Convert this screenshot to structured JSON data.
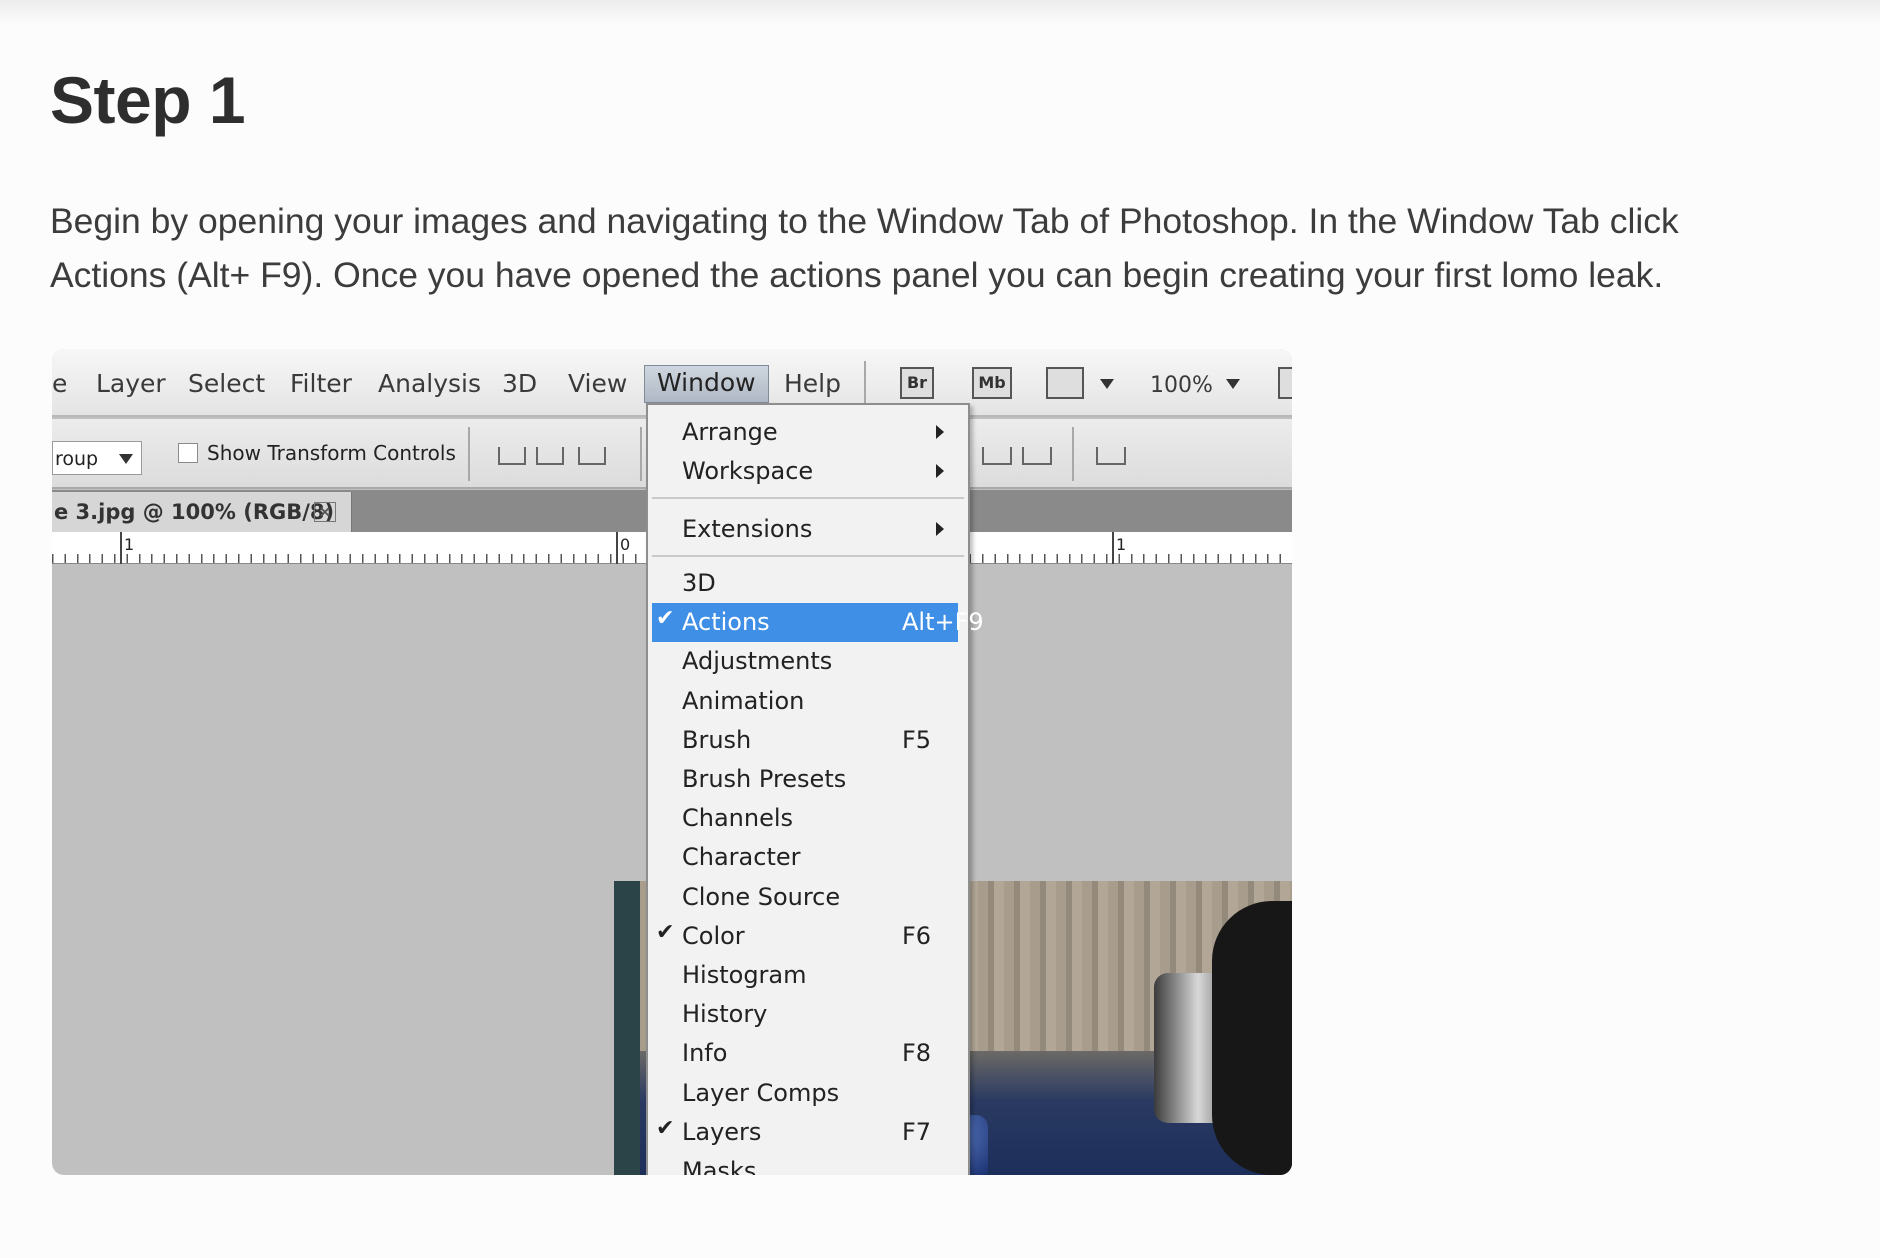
{
  "article": {
    "heading": "Step 1",
    "body": "Begin by opening your images and navigating to the Window Tab of Photoshop. In the Window Tab click Actions (Alt+ F9). Once you have opened the actions panel you can begin creating your first lomo leak."
  },
  "menubar": {
    "items": [
      "e",
      "Layer",
      "Select",
      "Filter",
      "Analysis",
      "3D",
      "View",
      "Window",
      "Help"
    ],
    "active": "Window",
    "icons": [
      "Br",
      "Mb"
    ],
    "zoom": "100%"
  },
  "options_bar": {
    "group_value": "roup",
    "show_transform_label": "Show Transform Controls"
  },
  "document_tab": {
    "title": "e 3.jpg @ 100% (RGB/8)",
    "close": "×"
  },
  "ruler": {
    "labels": [
      "1",
      "0",
      "1"
    ]
  },
  "window_menu": {
    "top_items": [
      {
        "label": "Arrange",
        "submenu": true
      },
      {
        "label": "Workspace",
        "submenu": true
      }
    ],
    "mid_items": [
      {
        "label": "Extensions",
        "submenu": true
      }
    ],
    "items": [
      {
        "label": "3D",
        "shortcut": "",
        "checked": false
      },
      {
        "label": "Actions",
        "shortcut": "Alt+F9",
        "checked": true,
        "highlighted": true
      },
      {
        "label": "Adjustments",
        "shortcut": "",
        "checked": false
      },
      {
        "label": "Animation",
        "shortcut": "",
        "checked": false
      },
      {
        "label": "Brush",
        "shortcut": "F5",
        "checked": false
      },
      {
        "label": "Brush Presets",
        "shortcut": "",
        "checked": false
      },
      {
        "label": "Channels",
        "shortcut": "",
        "checked": false
      },
      {
        "label": "Character",
        "shortcut": "",
        "checked": false
      },
      {
        "label": "Clone Source",
        "shortcut": "",
        "checked": false
      },
      {
        "label": "Color",
        "shortcut": "F6",
        "checked": true
      },
      {
        "label": "Histogram",
        "shortcut": "",
        "checked": false
      },
      {
        "label": "History",
        "shortcut": "",
        "checked": false
      },
      {
        "label": "Info",
        "shortcut": "F8",
        "checked": false
      },
      {
        "label": "Layer Comps",
        "shortcut": "",
        "checked": false
      },
      {
        "label": "Layers",
        "shortcut": "F7",
        "checked": true
      },
      {
        "label": "Masks",
        "shortcut": "",
        "checked": false
      }
    ],
    "check_glyph": "✔",
    "highlight_color": "#3f8fe6"
  }
}
